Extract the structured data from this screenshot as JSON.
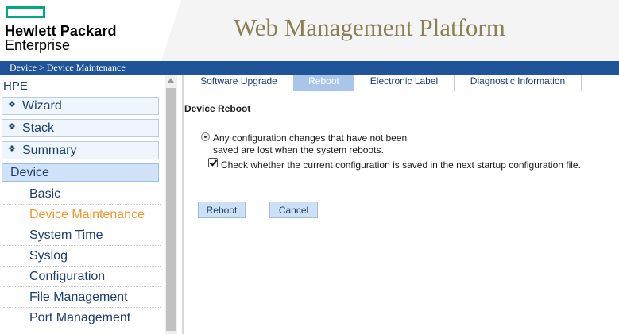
{
  "brand": {
    "line1": "Hewlett Packard",
    "line2": "Enterprise",
    "accent_color": "#01a982"
  },
  "header": {
    "title": "Web Management Platform"
  },
  "breadcrumb": {
    "text": "Device > Device Maintenance"
  },
  "sidebar": {
    "root": "HPE",
    "groups": [
      {
        "label": "Wizard",
        "bullet": "❖"
      },
      {
        "label": "Stack",
        "bullet": "❖"
      },
      {
        "label": "Summary",
        "bullet": "❖"
      }
    ],
    "active_group": "Device",
    "items": [
      {
        "label": "Basic"
      },
      {
        "label": "Device Maintenance"
      },
      {
        "label": "System Time"
      },
      {
        "label": "Syslog"
      },
      {
        "label": "Configuration"
      },
      {
        "label": "File Management"
      },
      {
        "label": "Port Management"
      }
    ],
    "current_item_color": "#f0962a"
  },
  "tabs": [
    {
      "label": "Software Upgrade"
    },
    {
      "label": "Reboot"
    },
    {
      "label": "Electronic Label"
    },
    {
      "label": "Diagnostic Information"
    }
  ],
  "content": {
    "title": "Device Reboot",
    "warning_line1": "Any configuration changes that have not been",
    "warning_line2": "saved are lost when the system reboots.",
    "check_label": "Check whether the current configuration is saved in the next startup configuration file.",
    "check_checked": true,
    "reboot_label": "Reboot",
    "cancel_label": "Cancel"
  }
}
